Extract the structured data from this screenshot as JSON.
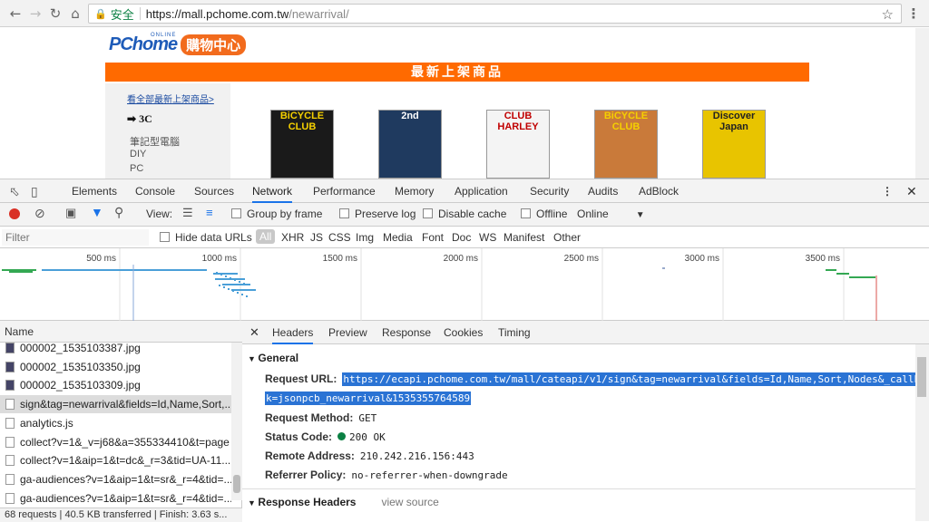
{
  "browser": {
    "secure_label": "安全",
    "url_host": "https://mall.pchome.com.tw",
    "url_path": "/newarrival/"
  },
  "page": {
    "logo_main": "PChome",
    "logo_online": "ONLINE",
    "logo_mall": "購物中心",
    "banner": "最新上架商品",
    "see_all_link": "看全部最新上架商品>",
    "category": "3C",
    "subcategories": [
      "筆記型電腦",
      "DIY",
      "PC"
    ],
    "magazines": [
      {
        "title": "BiCYCLE CLUB",
        "color": "#1a1a1a",
        "tcolor": "#f5d000"
      },
      {
        "title": "2nd",
        "color": "#1f3a5f",
        "tcolor": "#ffffff"
      },
      {
        "title": "CLUB HARLEY",
        "color": "#f4f4f4",
        "tcolor": "#c00000"
      },
      {
        "title": "BiCYCLE CLUB",
        "color": "#c97a3a",
        "tcolor": "#f5d000"
      },
      {
        "title": "Discover Japan",
        "color": "#e8c400",
        "tcolor": "#222222"
      }
    ]
  },
  "devtools": {
    "tabs": [
      "Elements",
      "Console",
      "Sources",
      "Network",
      "Performance",
      "Memory",
      "Application",
      "Security",
      "Audits",
      "AdBlock"
    ],
    "active_tab": "Network",
    "toolbar": {
      "view_label": "View:",
      "group_by_frame": "Group by frame",
      "preserve_log": "Preserve log",
      "disable_cache": "Disable cache",
      "offline": "Offline",
      "throttle": "Online"
    },
    "filter": {
      "placeholder": "Filter",
      "hide_data_urls": "Hide data URLs",
      "types": [
        "All",
        "XHR",
        "JS",
        "CSS",
        "Img",
        "Media",
        "Font",
        "Doc",
        "WS",
        "Manifest",
        "Other"
      ]
    },
    "timeline_ticks": [
      "500 ms",
      "1000 ms",
      "1500 ms",
      "2000 ms",
      "2500 ms",
      "3000 ms",
      "3500 ms"
    ],
    "request_list": {
      "header": "Name",
      "rows": [
        {
          "name": "000002_1535103387.jpg",
          "type": "img"
        },
        {
          "name": "000002_1535103350.jpg",
          "type": "img"
        },
        {
          "name": "000002_1535103309.jpg",
          "type": "img"
        },
        {
          "name": "sign&tag=newarrival&fields=Id,Name,Sort,...",
          "type": "doc"
        },
        {
          "name": "analytics.js",
          "type": "doc"
        },
        {
          "name": "collect?v=1&_v=j68&a=355334410&t=page",
          "type": "doc"
        },
        {
          "name": "collect?v=1&aip=1&t=dc&_r=3&tid=UA-11...",
          "type": "doc"
        },
        {
          "name": "ga-audiences?v=1&aip=1&t=sr&_r=4&tid=...",
          "type": "doc"
        },
        {
          "name": "ga-audiences?v=1&aip=1&t=sr&_r=4&tid=...",
          "type": "doc"
        }
      ],
      "status": "68 requests | 40.5 KB transferred | Finish: 3.63 s..."
    },
    "details": {
      "tabs": [
        "Headers",
        "Preview",
        "Response",
        "Cookies",
        "Timing"
      ],
      "active_tab": "Headers",
      "general_title": "General",
      "request_url_label": "Request URL:",
      "request_url_line1": "https://ecapi.pchome.com.tw/mall/cateapi/v1/sign&tag=newarrival&fields=Id,Name,Sort,Nodes&_callbac",
      "request_url_line2": "k=jsonpcb_newarrival&1535355764589",
      "method_label": "Request Method:",
      "method": "GET",
      "status_label": "Status Code:",
      "status": "200 OK",
      "remote_label": "Remote Address:",
      "remote": "210.242.216.156:443",
      "referrer_label": "Referrer Policy:",
      "referrer": "no-referrer-when-downgrade",
      "response_headers_title": "Response Headers",
      "view_source": "view source"
    }
  }
}
